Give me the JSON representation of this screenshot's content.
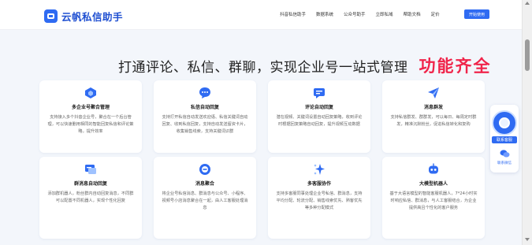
{
  "brand": {
    "name": "云帆私信助手",
    "accent": "#2f6bf2"
  },
  "nav": {
    "items": [
      "抖音私信助手",
      "数据系统",
      "公众号助手",
      "立即私域",
      "帮助文档",
      "定价"
    ],
    "cta": "开始使用"
  },
  "headline": {
    "main": "打通评论、私信、群聊，实现企业号一站式管理",
    "accent": "功能齐全",
    "accent_color": "#f0244a"
  },
  "features": [
    {
      "icon": "cube-icon",
      "title": "多企业号聚合管理",
      "desc": "支持接入多个抖音企业号，聚合在一个后台管理，可以快速删用相同的智能回复私信和评论策略，提升效率"
    },
    {
      "icon": "chat-bubble-icon",
      "title": "私信自动回复",
      "desc": "支持打开私信自动发送欢迎语、私信关键词自动回复、收到私信回复，支持自动发送留资卡片，收集销售线索，支持关键词识群"
    },
    {
      "icon": "comment-icon",
      "title": "评论自动回复",
      "desc": "潜在视频、关键词设置自动回复策略，收到评论时根据回复策略自动回复，提升视频互动数据"
    },
    {
      "icon": "paper-plane-icon",
      "title": "消息群发",
      "desc": "支持私信群发、群群发，可以每日、每周定时群发，精准沉默粉丝，促进私信转化和复购"
    },
    {
      "icon": "group-message-icon",
      "title": "群消息自动回复",
      "desc": "添加群机器人，粉丝群内自动回复消息，不同群可以配置不同机器人，实现个性化回复"
    },
    {
      "icon": "message-merge-icon",
      "title": "消息聚合",
      "desc": "将企业号私信消息、群消息与公众号、小程序、视频号小店消息聚合在一起，由人工客服处理消息"
    },
    {
      "icon": "sparkle-icon",
      "title": "多客服协作",
      "desc": "支持多客服同事处理企业号私信、群消息，支持平均分配、轮流分配、销售线索优先、熟客优先等多种分配模式"
    },
    {
      "icon": "robot-icon",
      "title": "大模型机器人",
      "desc": "基于大语言模型的智能客服机器人，7*24小时实时响应私信、群消息，与人工客服结合，为企业提供高且个性化的客户服务"
    }
  ],
  "float_panel": {
    "service_label": "联系客服",
    "wechat_label": "联系微信"
  }
}
